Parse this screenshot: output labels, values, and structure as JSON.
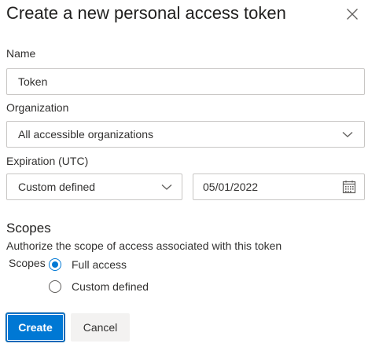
{
  "dialog": {
    "title": "Create a new personal access token",
    "close_icon": "close-icon"
  },
  "form": {
    "name": {
      "label": "Name",
      "value": "Token"
    },
    "organization": {
      "label": "Organization",
      "value": "All accessible organizations",
      "icon": "chevron-down-icon"
    },
    "expiration": {
      "label": "Expiration (UTC)",
      "preset": "Custom defined",
      "preset_icon": "chevron-down-icon",
      "date": "05/01/2022",
      "date_icon": "calendar-icon"
    }
  },
  "scopes": {
    "heading": "Scopes",
    "description": "Authorize the scope of access associated with this token",
    "group_label": "Scopes",
    "options": [
      {
        "label": "Full access",
        "selected": true
      },
      {
        "label": "Custom defined",
        "selected": false
      }
    ]
  },
  "actions": {
    "create_label": "Create",
    "cancel_label": "Cancel"
  },
  "colors": {
    "accent": "#0078d4",
    "border": "#c8c6c4",
    "secondary_button": "#f3f2f1"
  }
}
